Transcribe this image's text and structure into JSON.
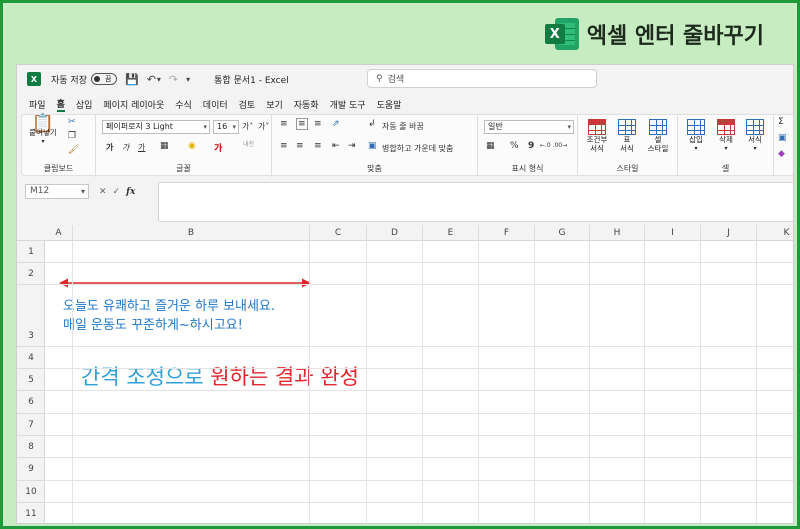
{
  "banner": {
    "title": "엑셀 엔터 줄바꾸기",
    "logo_letter": "X"
  },
  "titlebar": {
    "app_letter": "X",
    "autosave_label": "자동 저장",
    "toggle_state": "끔",
    "doc_title": "통합 문서1 - Excel",
    "search_placeholder": "검색"
  },
  "menu": {
    "tabs": [
      "파일",
      "홈",
      "삽입",
      "페이지 레이아웃",
      "수식",
      "데이터",
      "검토",
      "보기",
      "자동화",
      "개발 도구",
      "도움말"
    ],
    "active": "홈"
  },
  "ribbon": {
    "clipboard": {
      "paste_label": "붙여넣기",
      "group_label": "클립보드"
    },
    "font": {
      "name": "페이퍼로지 3 Light",
      "size": "16",
      "grow": "가˄",
      "shrink": "가˅",
      "bold": "가",
      "italic": "가",
      "underline": "가",
      "group_label": "글꼴",
      "phonetic": "내천"
    },
    "alignment": {
      "wrap_label": "자동 줄 바꿈",
      "merge_label": "병합하고 가운데 맞춤",
      "group_label": "맞춤"
    },
    "number": {
      "format": "일반",
      "group_label": "표시 형식",
      "percent": "%",
      "comma": "9",
      "incdec": "←.0  .00→"
    },
    "styles": {
      "cond_label_1": "조건부",
      "cond_label_2": "서식",
      "table_label_1": "표",
      "table_label_2": "서식",
      "cell_label_1": "셀",
      "cell_label_2": "스타일",
      "group_label": "스타일"
    },
    "cells": {
      "insert_label": "삽입",
      "delete_label": "삭제",
      "format_label": "서식",
      "group_label": "셀"
    }
  },
  "formula_bar": {
    "name_box": "M12",
    "fx": "fx"
  },
  "sheet": {
    "columns": [
      "A",
      "B",
      "C",
      "D",
      "E",
      "F",
      "G",
      "H",
      "I",
      "J",
      "K"
    ],
    "rows": [
      "1",
      "2",
      "3",
      "4",
      "5",
      "6",
      "7",
      "8",
      "9",
      "10",
      "11"
    ],
    "cell_lines": [
      "오늘도 유쾌하고 즐거운 하루 보내세요.",
      "매일 운동도 꾸준하게~하시고요!"
    ]
  },
  "caption": {
    "part1": "간격 조정으로",
    "part2": "원하는 결과 완성"
  },
  "colors": {
    "frame": "#1f9a3a",
    "banner_bg": "#c8ecc2",
    "cell_text": "#1f76c8",
    "caption_blue": "#2e9fd8",
    "caption_red": "#e0262c",
    "arrow": "#e0262c",
    "excel_green": "#107c41"
  }
}
